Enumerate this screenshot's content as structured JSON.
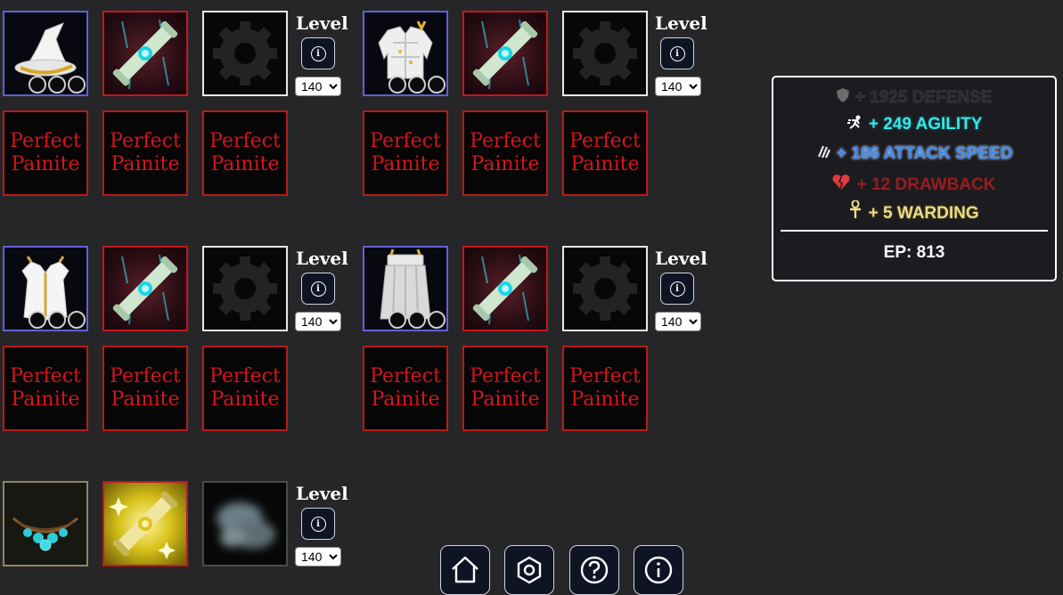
{
  "equipment_groups": [
    {
      "id": "helmet",
      "item": "white wizard hat",
      "sockets": 3,
      "rune": "teal scroll",
      "level_label": "Level",
      "level_value": "140",
      "gems": [
        "Perfect Painite",
        "Perfect Painite",
        "Perfect Painite"
      ]
    },
    {
      "id": "chest",
      "item": "white plate armor",
      "sockets": 3,
      "rune": "teal scroll",
      "level_label": "Level",
      "level_value": "140",
      "gems": [
        "Perfect Painite",
        "Perfect Painite",
        "Perfect Painite"
      ]
    },
    {
      "id": "chest-robe",
      "item": "white robe",
      "sockets": 3,
      "rune": "teal scroll",
      "level_label": "Level",
      "level_value": "140",
      "gems": [
        "Perfect Painite",
        "Perfect Painite",
        "Perfect Painite"
      ]
    },
    {
      "id": "legs",
      "item": "white greaves",
      "sockets": 3,
      "rune": "teal scroll",
      "level_label": "Level",
      "level_value": "140",
      "gems": [
        "Perfect Painite",
        "Perfect Painite",
        "Perfect Painite"
      ]
    },
    {
      "id": "amulet",
      "item": "teal gem necklace",
      "rune": "gold scroll",
      "level_label": "Level",
      "level_value": "140"
    }
  ],
  "level_options": [
    "140"
  ],
  "stats": [
    {
      "prefix": "+",
      "value": "1925",
      "name": "DEFENSE",
      "icon": "shield-icon",
      "color": "#2b2b2e"
    },
    {
      "prefix": "+",
      "value": "249",
      "name": "AGILITY",
      "icon": "runner-icon",
      "color": "#39e6e8"
    },
    {
      "prefix": "+",
      "value": "186",
      "name": "ATTACK SPEED",
      "icon": "claw-icon",
      "color": "#3a8cff"
    },
    {
      "prefix": "+",
      "value": "12",
      "name": "DRAWBACK",
      "icon": "broken-heart-icon",
      "color": "#9a1c1c"
    },
    {
      "prefix": "+",
      "value": "5",
      "name": "WARDING",
      "icon": "ankh-icon",
      "color": "#e8d98a"
    }
  ],
  "stats_text": [
    "+ 1925 DEFENSE",
    "+ 249 AGILITY",
    "+ 186 ATTACK SPEED",
    "+ 12 DRAWBACK",
    "+ 5 WARDING"
  ],
  "ep_text": "EP: 813",
  "nav": [
    {
      "icon": "home-icon"
    },
    {
      "icon": "settings-icon"
    },
    {
      "icon": "help-icon"
    },
    {
      "icon": "info-icon"
    }
  ],
  "info_glyph": "i"
}
